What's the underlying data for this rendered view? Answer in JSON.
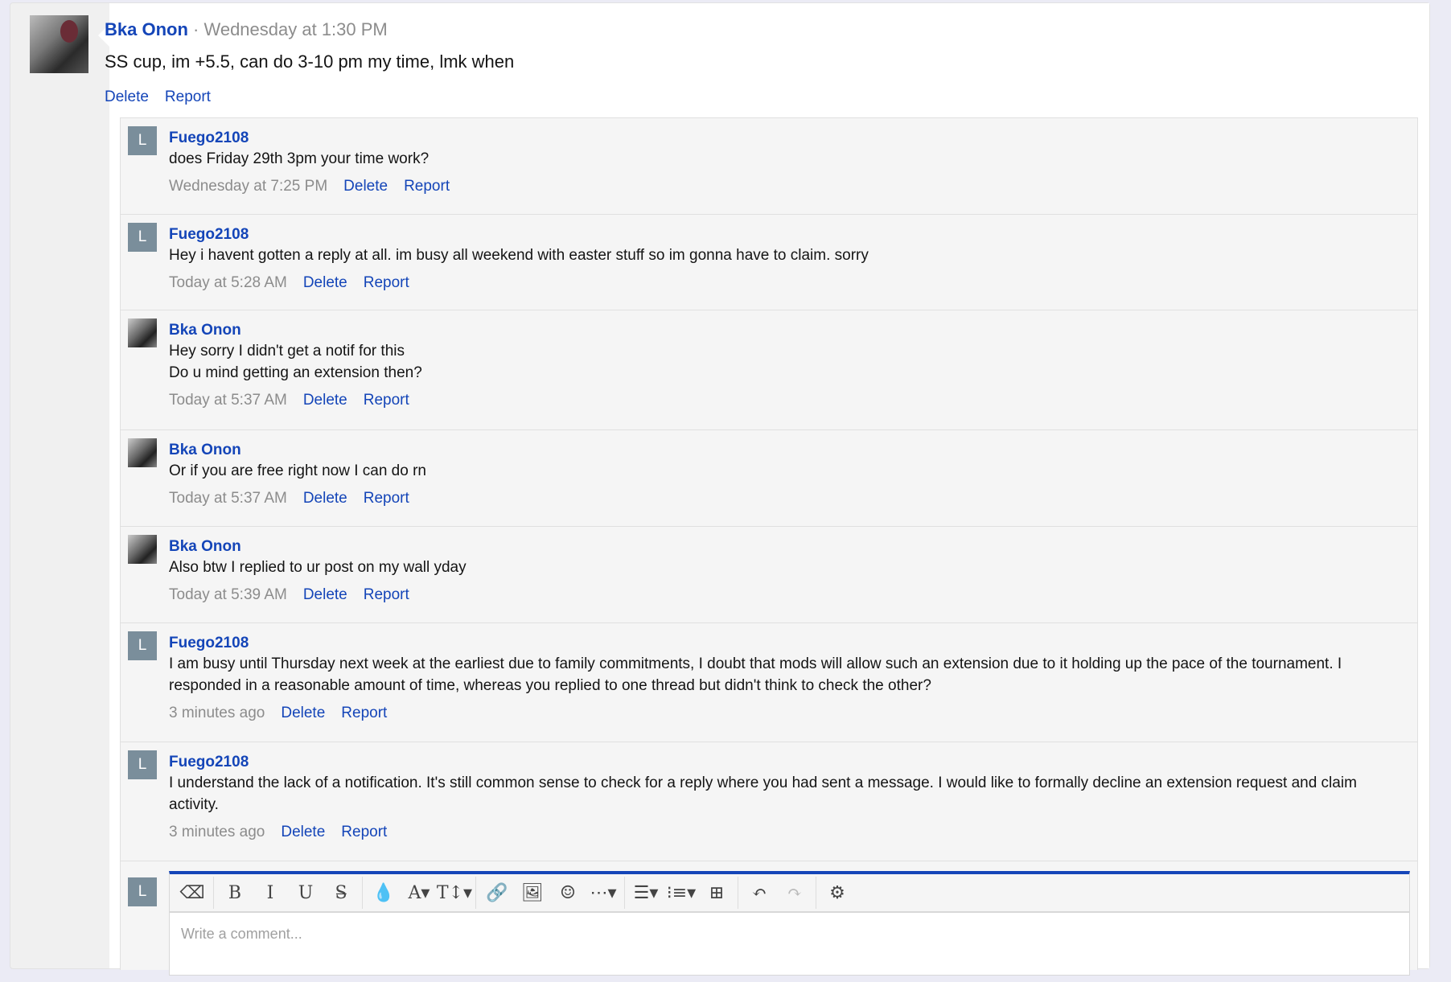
{
  "post": {
    "author": "Bka Onon",
    "time": "Wednesday at 1:30 PM",
    "sep": " · ",
    "message": "SS cup, im +5.5, can do 3-10 pm my time, lmk when",
    "delete": "Delete",
    "report": "Report"
  },
  "comments": [
    {
      "author": "Fuego2108",
      "avatar": "L",
      "text": "does Friday 29th 3pm your time work?",
      "time": "Wednesday at 7:25 PM"
    },
    {
      "author": "Fuego2108",
      "avatar": "L",
      "text": "Hey i havent gotten a reply at all. im busy all weekend with easter stuff so im gonna have to claim. sorry",
      "time": "Today at 5:28 AM"
    },
    {
      "author": "Bka Onon",
      "avatar": "",
      "text": "Hey sorry I didn't get a notif for this\nDo u mind getting an extension then?",
      "time": "Today at 5:37 AM"
    },
    {
      "author": "Bka Onon",
      "avatar": "",
      "text": "Or if you are free right now I can do rn",
      "time": "Today at 5:37 AM"
    },
    {
      "author": "Bka Onon",
      "avatar": "",
      "text": "Also btw I replied to ur post on my wall yday",
      "time": "Today at 5:39 AM"
    },
    {
      "author": "Fuego2108",
      "avatar": "L",
      "text": "I am busy until Thursday next week at the earliest due to family commitments, I doubt that mods will allow such an extension due to it holding up the pace of the tournament. I responded in a reasonable amount of time, whereas you replied to one thread but didn't think to check the other?",
      "time": "3 minutes ago"
    },
    {
      "author": "Fuego2108",
      "avatar": "L",
      "text": "I understand the lack of a notification. It's still common sense to check for a reply where you had sent a message. I would like to formally decline an extension request and claim activity.",
      "time": "3 minutes ago"
    }
  ],
  "labels": {
    "delete": "Delete",
    "report": "Report"
  },
  "editor": {
    "avatar": "L",
    "placeholder": "Write a comment...",
    "toolbar": [
      {
        "icon": "eraser-icon",
        "glyph": "⌫"
      },
      {
        "sep": true
      },
      {
        "icon": "bold-icon",
        "glyph": "B"
      },
      {
        "icon": "italic-icon",
        "glyph": "I"
      },
      {
        "icon": "underline-icon",
        "glyph": "U"
      },
      {
        "icon": "strikethrough-icon",
        "glyph": "S̶"
      },
      {
        "sep": true
      },
      {
        "icon": "color-icon",
        "glyph": "💧"
      },
      {
        "icon": "font-family-icon",
        "glyph": "A▾"
      },
      {
        "icon": "font-size-icon",
        "glyph": "T↕▾"
      },
      {
        "sep": true
      },
      {
        "icon": "link-icon",
        "glyph": "🔗"
      },
      {
        "icon": "image-icon",
        "glyph": "🖼"
      },
      {
        "icon": "emoji-icon",
        "glyph": "☺"
      },
      {
        "icon": "more-icon",
        "glyph": "⋯▾"
      },
      {
        "sep": true
      },
      {
        "icon": "align-icon",
        "glyph": "☰▾"
      },
      {
        "icon": "list-icon",
        "glyph": "⁝≡▾"
      },
      {
        "icon": "table-icon",
        "glyph": "⊞"
      },
      {
        "sep": true
      },
      {
        "icon": "undo-icon",
        "glyph": "↶"
      },
      {
        "icon": "redo-icon",
        "glyph": "↷",
        "disabled": true
      },
      {
        "sep": true
      },
      {
        "icon": "settings-icon",
        "glyph": "⚙"
      }
    ]
  }
}
